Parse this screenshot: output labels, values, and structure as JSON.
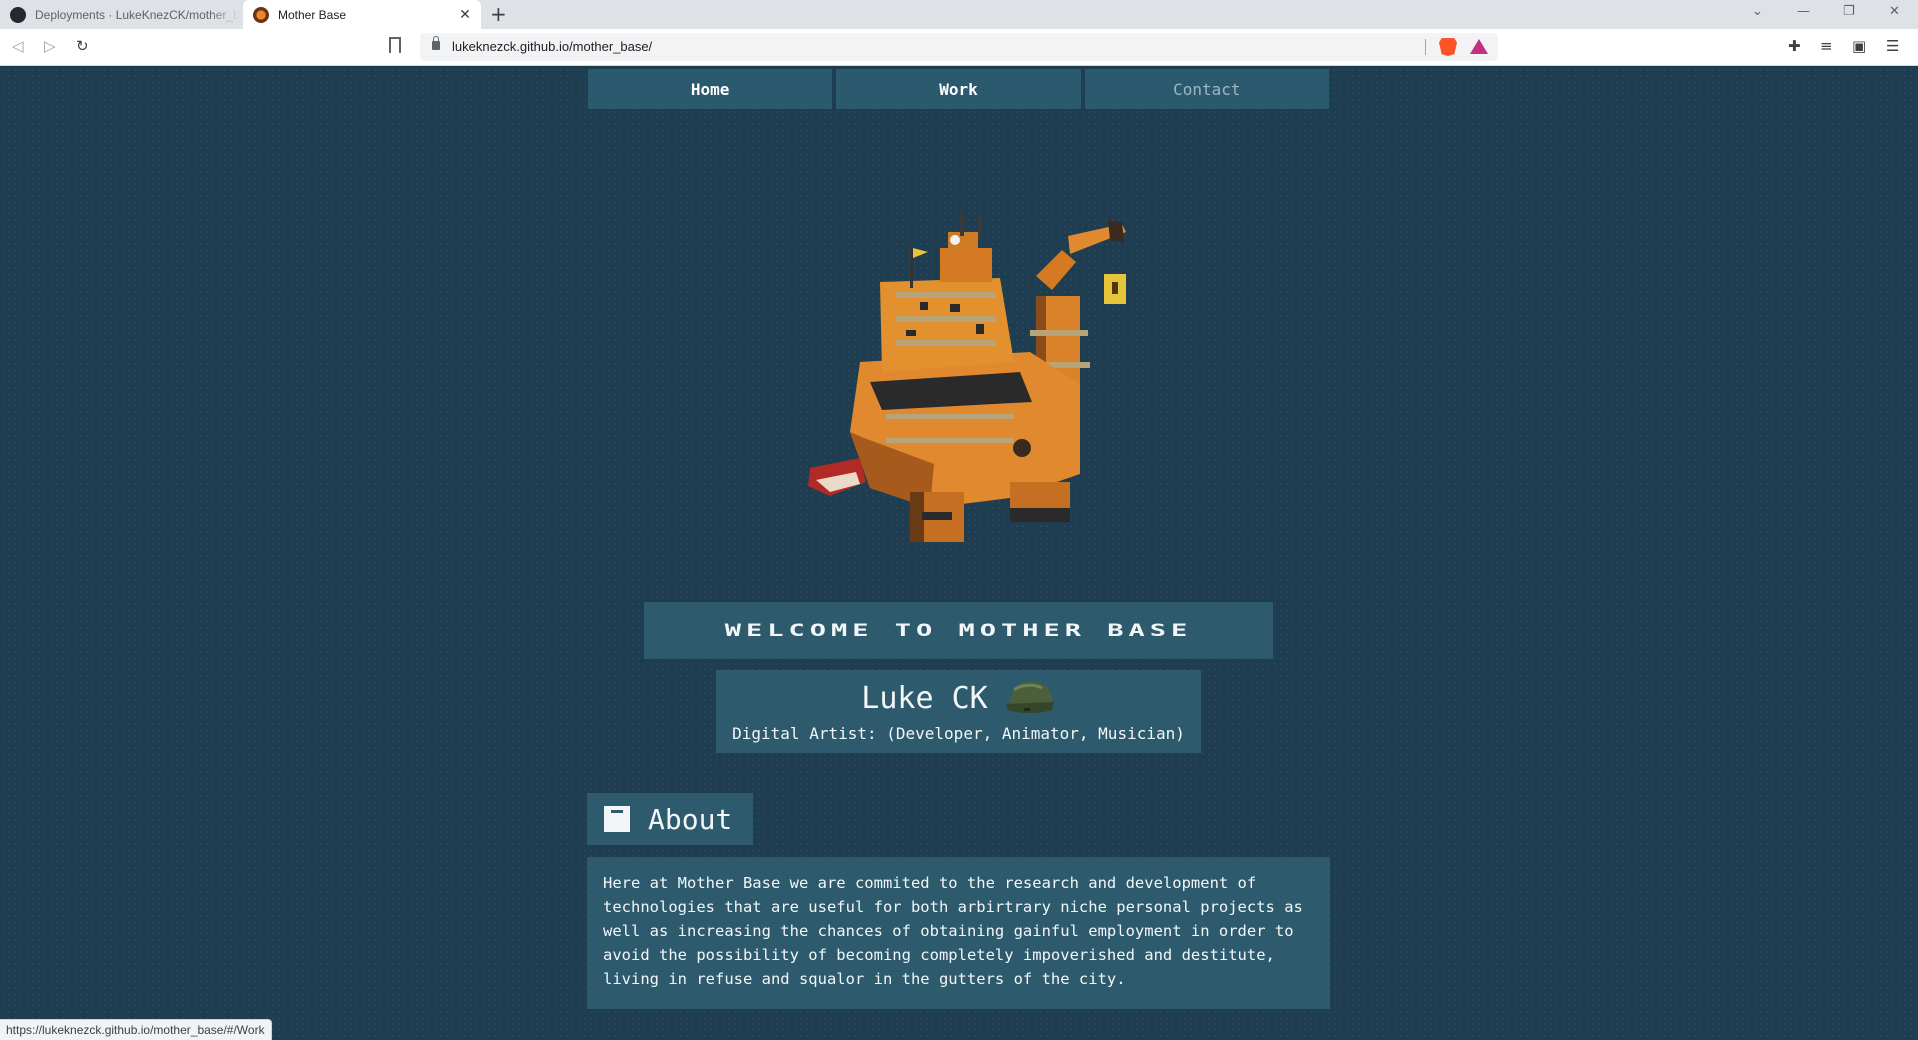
{
  "browser": {
    "tabs": [
      {
        "title": "Deployments · LukeKnezCK/mother_base",
        "active": false
      },
      {
        "title": "Mother Base",
        "active": true
      }
    ],
    "url": "lukeknezck.github.io/mother_base/",
    "status_url": "https://lukeknezck.github.io/mother_base/#/Work"
  },
  "nav": {
    "items": [
      "Home",
      "Work",
      "Contact"
    ]
  },
  "hero": {
    "image_icon": "oil-rig-voxel-icon",
    "primary_color": "#e0892e"
  },
  "welcome": {
    "text": "WELCOME TO MOTHER BASE"
  },
  "profile": {
    "name": "Luke CK",
    "subtitle": "Digital Artist: (Developer, Animator, Musician)",
    "badge_icon": "helmet-icon"
  },
  "about": {
    "heading": "About",
    "icon": "folder-icon",
    "body": "Here at Mother Base we are commited to the research and development of technologies that are useful for both arbirtrary niche personal projects as well as increasing the chances of obtaining gainful employment in order to avoid the possibility of becoming completely impoverished and destitute, living in refuse and squalor in the gutters of the city."
  },
  "colors": {
    "background": "#1f3d50",
    "panel": "#2d5b6d",
    "text": "#f2f6f8"
  }
}
